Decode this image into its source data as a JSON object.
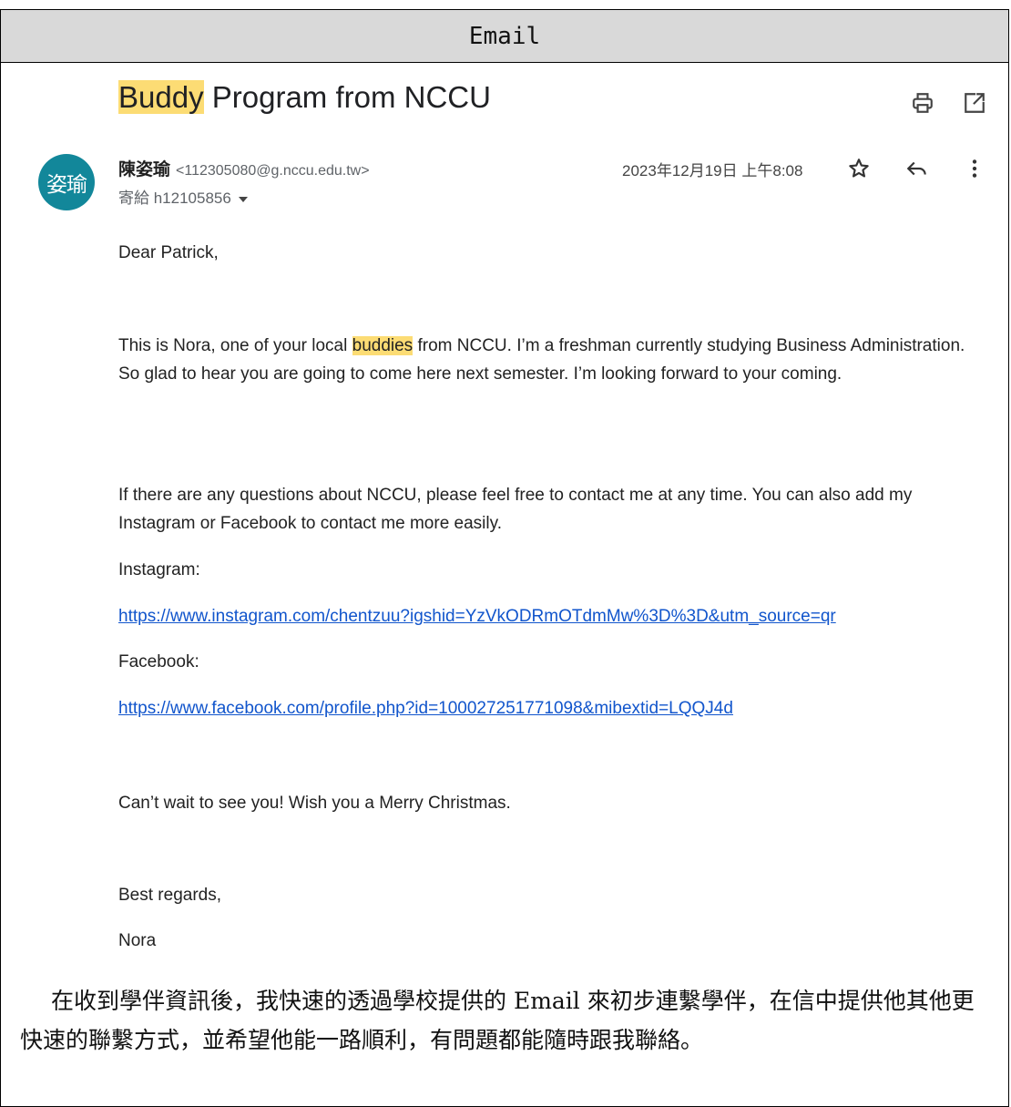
{
  "table": {
    "header": "Email"
  },
  "email": {
    "subject_highlight": "Buddy",
    "subject_rest": " Program from NCCU",
    "avatar_text": "姿瑜",
    "sender_name": "陳姿瑜",
    "sender_email": "<112305080@g.nccu.edu.tw>",
    "recipient": "寄給 h12105856",
    "date": "2023年12月19日 上午8:08",
    "icons": [
      "print-icon",
      "open-in-new-window-icon",
      "star-icon",
      "reply-icon",
      "more-vert-icon",
      "caret-down-icon"
    ],
    "highlight_color": "#fcdc74",
    "avatar_color": "#12879a",
    "link_color": "#1155cc",
    "greeting": "Dear Patrick,",
    "p1_before": "This is Nora, one of your local ",
    "p1_highlight": "buddies",
    "p1_after": " from NCCU. I’m a freshman currently studying Business Administration. So glad to hear you are going to come here next semester. I’m looking forward to your coming.",
    "p2": "If there are any questions about NCCU, please feel free to contact me at any time. You can also add my Instagram or Facebook to contact me more easily.",
    "instagram_label": "Instagram:",
    "instagram_link": "https://www.instagram.com/chentzuu?igshid=YzVkODRmOTdmMw%3D%3D&utm_source=qr",
    "facebook_label": "Facebook:",
    "facebook_link": "https://www.facebook.com/profile.php?id=100027251771098&mibextid=LQQJ4d",
    "closing": "Can’t wait to see you! Wish you a Merry Christmas.",
    "signoff": "Best regards,",
    "signature": "Nora"
  },
  "essay": "在收到學伴資訊後，我快速的透過學校提供的 Email 來初步連繫學伴，在信中提供他其他更快速的聯繫方式，並希望他能一路順利，有問題都能隨時跟我聯絡。"
}
